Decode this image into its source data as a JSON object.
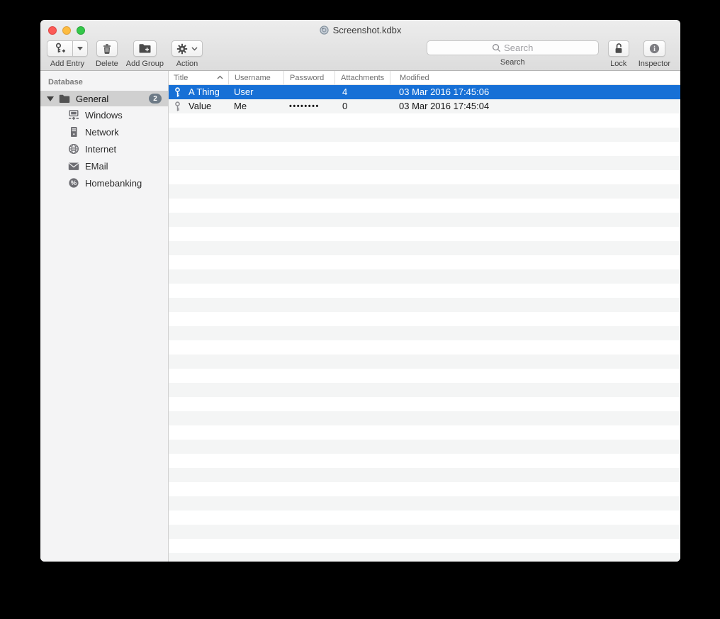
{
  "window": {
    "title": "Screenshot.kdbx"
  },
  "toolbar": {
    "add_entry": {
      "label": "Add Entry"
    },
    "delete": {
      "label": "Delete"
    },
    "add_group": {
      "label": "Add Group"
    },
    "action": {
      "label": "Action"
    },
    "search": {
      "placeholder": "Search",
      "label": "Search"
    },
    "lock": {
      "label": "Lock"
    },
    "inspector": {
      "label": "Inspector"
    }
  },
  "sidebar": {
    "section_label": "Database",
    "root": {
      "label": "General",
      "badge": "2"
    },
    "items": [
      {
        "label": "Windows",
        "icon": "windows-icon"
      },
      {
        "label": "Network",
        "icon": "server-icon"
      },
      {
        "label": "Internet",
        "icon": "globe-icon"
      },
      {
        "label": "EMail",
        "icon": "envelope-icon"
      },
      {
        "label": "Homebanking",
        "icon": "percent-icon"
      }
    ]
  },
  "table": {
    "columns": [
      "Title",
      "Username",
      "Password",
      "Attachments",
      "Modified"
    ],
    "sorted_column": "Title",
    "rows": [
      {
        "title": "A Thing",
        "username": "User",
        "password": "",
        "attachments": "4",
        "modified": "03 Mar 2016 17:45:06",
        "selected": true
      },
      {
        "title": "Value",
        "username": "Me",
        "password": "••••••••",
        "attachments": "0",
        "modified": "03 Mar 2016 17:45:04",
        "selected": false
      }
    ]
  },
  "colors": {
    "selection_blue": "#1770d6",
    "row_stripe": "#f4f5f5",
    "sidebar_selection": "#d0d0d0",
    "badge_gray": "#6d7a86",
    "traffic_red": "#fc5b57",
    "traffic_yellow": "#fdbc40",
    "traffic_green": "#34c84a"
  },
  "icons": [
    "key-plus-icon",
    "caret-down-icon",
    "trash-icon",
    "folder-plus-icon",
    "gear-icon",
    "chevron-down-icon",
    "search-icon",
    "lock-open-icon",
    "info-icon",
    "document-icon",
    "disclosure-triangle-icon",
    "folder-icon",
    "windows-icon",
    "server-icon",
    "globe-icon",
    "envelope-icon",
    "percent-icon",
    "key-icon",
    "sort-asc-icon"
  ]
}
